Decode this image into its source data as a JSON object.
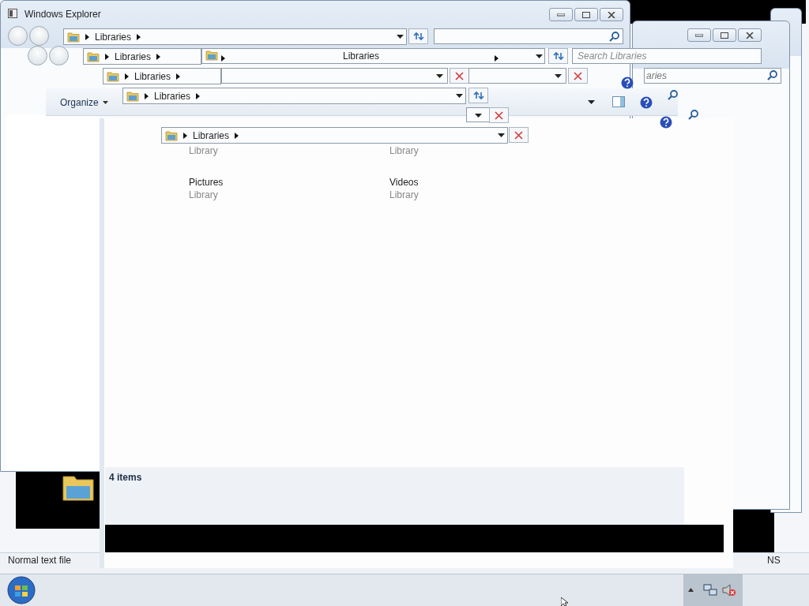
{
  "window": {
    "title": "Windows Explorer"
  },
  "address_bars": [
    {
      "crumb": "Libraries"
    },
    {
      "crumb": "Libraries"
    },
    {
      "crumb": "Libraries"
    },
    {
      "crumb": "Libraries"
    },
    {
      "crumb": "Libraries"
    }
  ],
  "wide_address": {
    "label": "Libraries"
  },
  "search": {
    "placeholder": "Search Libraries",
    "partial": "aries"
  },
  "toolbar": {
    "organize": "Organize"
  },
  "items": [
    {
      "subtitle": "Library"
    },
    {
      "subtitle": "Library"
    },
    {
      "name": "Pictures",
      "subtitle": "Library"
    },
    {
      "name": "Videos",
      "subtitle": "Library"
    }
  ],
  "status": "4 items",
  "details": {
    "file_type": "Normal text file",
    "fragment": "NS"
  }
}
